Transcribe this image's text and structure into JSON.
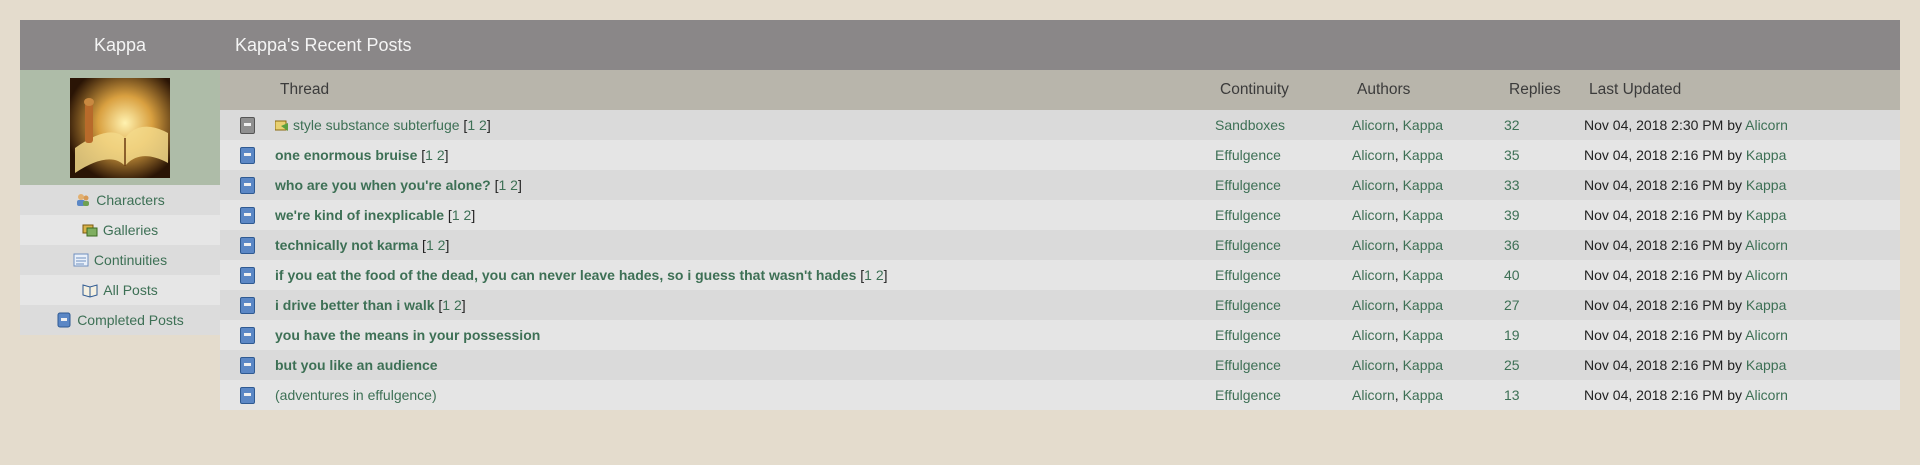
{
  "header": {
    "user_name": "Kappa",
    "page_title": "Kappa's Recent Posts"
  },
  "sidebar": {
    "items": [
      {
        "label": "Characters",
        "icon": "characters-icon"
      },
      {
        "label": "Galleries",
        "icon": "galleries-icon"
      },
      {
        "label": "Continuities",
        "icon": "continuities-icon"
      },
      {
        "label": "All Posts",
        "icon": "all-posts-icon"
      },
      {
        "label": "Completed Posts",
        "icon": "completed-posts-icon"
      }
    ]
  },
  "table": {
    "columns": {
      "thread": "Thread",
      "continuity": "Continuity",
      "authors": "Authors",
      "replies": "Replies",
      "last_updated": "Last Updated"
    },
    "by_label": "by",
    "author_separator": ",",
    "rows": [
      {
        "icon": "gray",
        "has_new": true,
        "bold": false,
        "title": "style substance subterfuge",
        "pages": [
          "1",
          "2"
        ],
        "continuity": "Sandboxes",
        "author1": "Alicorn",
        "author2": "Kappa",
        "replies": "32",
        "date": "Nov 04, 2018 2:30 PM",
        "last_by": "Alicorn"
      },
      {
        "icon": "blue",
        "has_new": false,
        "bold": true,
        "title": "one enormous bruise",
        "pages": [
          "1",
          "2"
        ],
        "continuity": "Effulgence",
        "author1": "Alicorn",
        "author2": "Kappa",
        "replies": "35",
        "date": "Nov 04, 2018 2:16 PM",
        "last_by": "Kappa"
      },
      {
        "icon": "blue",
        "has_new": false,
        "bold": true,
        "title": "who are you when you're alone?",
        "pages": [
          "1",
          "2"
        ],
        "continuity": "Effulgence",
        "author1": "Alicorn",
        "author2": "Kappa",
        "replies": "33",
        "date": "Nov 04, 2018 2:16 PM",
        "last_by": "Kappa"
      },
      {
        "icon": "blue",
        "has_new": false,
        "bold": true,
        "title": "we're kind of inexplicable",
        "pages": [
          "1",
          "2"
        ],
        "continuity": "Effulgence",
        "author1": "Alicorn",
        "author2": "Kappa",
        "replies": "39",
        "date": "Nov 04, 2018 2:16 PM",
        "last_by": "Kappa"
      },
      {
        "icon": "blue",
        "has_new": false,
        "bold": true,
        "title": "technically not karma",
        "pages": [
          "1",
          "2"
        ],
        "continuity": "Effulgence",
        "author1": "Alicorn",
        "author2": "Kappa",
        "replies": "36",
        "date": "Nov 04, 2018 2:16 PM",
        "last_by": "Alicorn"
      },
      {
        "icon": "blue",
        "has_new": false,
        "bold": true,
        "title": "if you eat the food of the dead, you can never leave hades, so i guess that wasn't hades",
        "pages": [
          "1",
          "2"
        ],
        "continuity": "Effulgence",
        "author1": "Alicorn",
        "author2": "Kappa",
        "replies": "40",
        "date": "Nov 04, 2018 2:16 PM",
        "last_by": "Alicorn"
      },
      {
        "icon": "blue",
        "has_new": false,
        "bold": true,
        "title": "i drive better than i walk",
        "pages": [
          "1",
          "2"
        ],
        "continuity": "Effulgence",
        "author1": "Alicorn",
        "author2": "Kappa",
        "replies": "27",
        "date": "Nov 04, 2018 2:16 PM",
        "last_by": "Kappa"
      },
      {
        "icon": "blue",
        "has_new": false,
        "bold": true,
        "title": "you have the means in your possession",
        "pages": [],
        "continuity": "Effulgence",
        "author1": "Alicorn",
        "author2": "Kappa",
        "replies": "19",
        "date": "Nov 04, 2018 2:16 PM",
        "last_by": "Alicorn"
      },
      {
        "icon": "blue",
        "has_new": false,
        "bold": true,
        "title": "but you like an audience",
        "pages": [],
        "continuity": "Effulgence",
        "author1": "Alicorn",
        "author2": "Kappa",
        "replies": "25",
        "date": "Nov 04, 2018 2:16 PM",
        "last_by": "Kappa"
      },
      {
        "icon": "blue",
        "has_new": false,
        "bold": false,
        "title": "(adventures in effulgence)",
        "pages": [],
        "continuity": "Effulgence",
        "author1": "Alicorn",
        "author2": "Kappa",
        "replies": "13",
        "date": "Nov 04, 2018 2:16 PM",
        "last_by": "Alicorn"
      }
    ]
  },
  "colors": {
    "header_bg": "#8a8788",
    "table_head_bg": "#b8b5ab",
    "link": "#3d7055",
    "avatar_bg": "#aebca8"
  }
}
